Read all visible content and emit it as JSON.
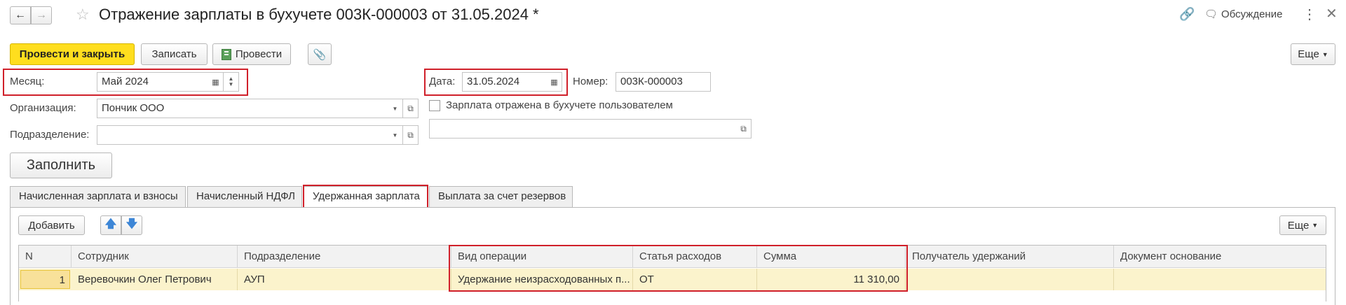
{
  "window": {
    "title": "Отражение зарплаты в бухучете 003К-000003 от 31.05.2024 *",
    "discussion_label": "Обсуждение"
  },
  "toolbar": {
    "post_close_label": "Провести и закрыть",
    "save_label": "Записать",
    "post_label": "Провести",
    "more_label": "Еще"
  },
  "form": {
    "month_label": "Месяц:",
    "month_value": "Май 2024",
    "date_label": "Дата:",
    "date_value": "31.05.2024",
    "number_label": "Номер:",
    "number_value": "003К-000003",
    "org_label": "Организация:",
    "org_value": "Пончик ООО",
    "dept_label": "Подразделение:",
    "dept_value": "",
    "reflected_checkbox_label": "Зарплата отражена в бухучете пользователем",
    "reflected_checked": false,
    "comment_value": "",
    "fill_label": "Заполнить"
  },
  "tabs": [
    {
      "label": "Начисленная зарплата и взносы",
      "active": false
    },
    {
      "label": "Начисленный НДФЛ",
      "active": false
    },
    {
      "label": "Удержанная зарплата",
      "active": true
    },
    {
      "label": "Выплата за счет резервов",
      "active": false
    }
  ],
  "table_toolbar": {
    "add_label": "Добавить",
    "more_label": "Еще"
  },
  "table": {
    "columns": [
      "N",
      "Сотрудник",
      "Подразделение",
      "Вид операции",
      "Статья расходов",
      "Сумма",
      "Получатель удержаний",
      "Документ основание"
    ],
    "rows": [
      [
        "1",
        "Веревочкин Олег Петрович",
        "АУП",
        "Удержание неизрасходованных п...",
        "ОТ",
        "11 310,00",
        "",
        ""
      ]
    ]
  },
  "colors": {
    "primary_button": "#ffde1e",
    "highlight": "#d0202a",
    "row_selected": "#fbf3cc",
    "arrow_blue": "#3d86d6"
  }
}
